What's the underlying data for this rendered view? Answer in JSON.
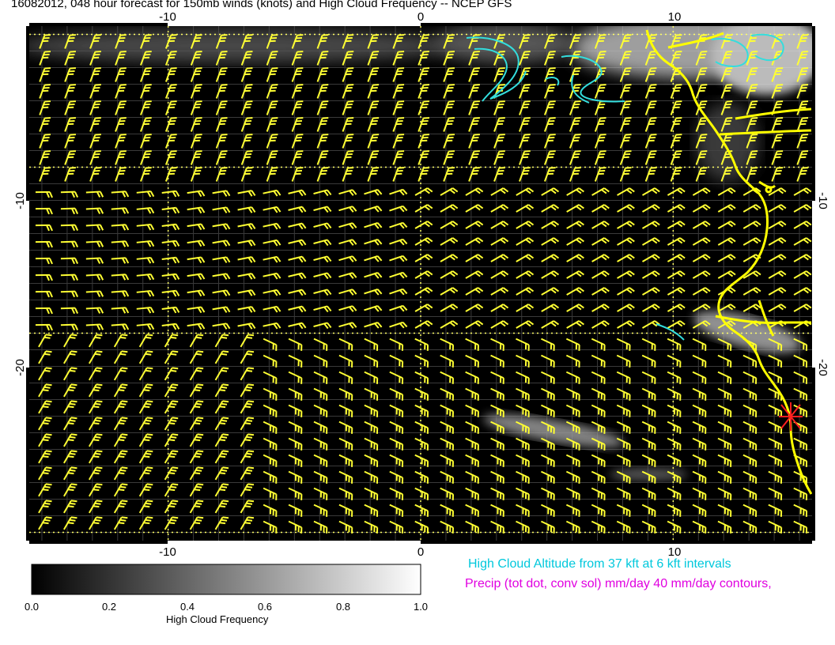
{
  "title": "16082012, 048 hour forecast for 150mb winds (knots) and High Cloud Frequency -- NCEP GFS",
  "map": {
    "lon_range": [
      -15.5,
      15.5
    ],
    "lat_range": [
      -32.5,
      -1.5
    ],
    "lon_ticks": [
      "-10",
      "0",
      "10"
    ],
    "lat_ticks": [
      "-10",
      "-20"
    ],
    "background_color": "#000000",
    "wind_barb_color": "#ffff33",
    "coast_color": "#ffff00",
    "cloud_contour_color": "#33dddd",
    "marker_color": "#ff2020",
    "gridline_style": "dotted-yellow"
  },
  "colorbar": {
    "label": "High Cloud Frequency",
    "ticks": [
      "0.0",
      "0.2",
      "0.4",
      "0.6",
      "0.8",
      "1.0"
    ],
    "range": [
      0.0,
      1.0
    ]
  },
  "legend": {
    "cloud_altitude": "High Cloud Altitude from 37 kft at 6 kft intervals",
    "precip": "Precip (tot dot, conv sol) mm/day 40 mm/day contours,"
  }
}
